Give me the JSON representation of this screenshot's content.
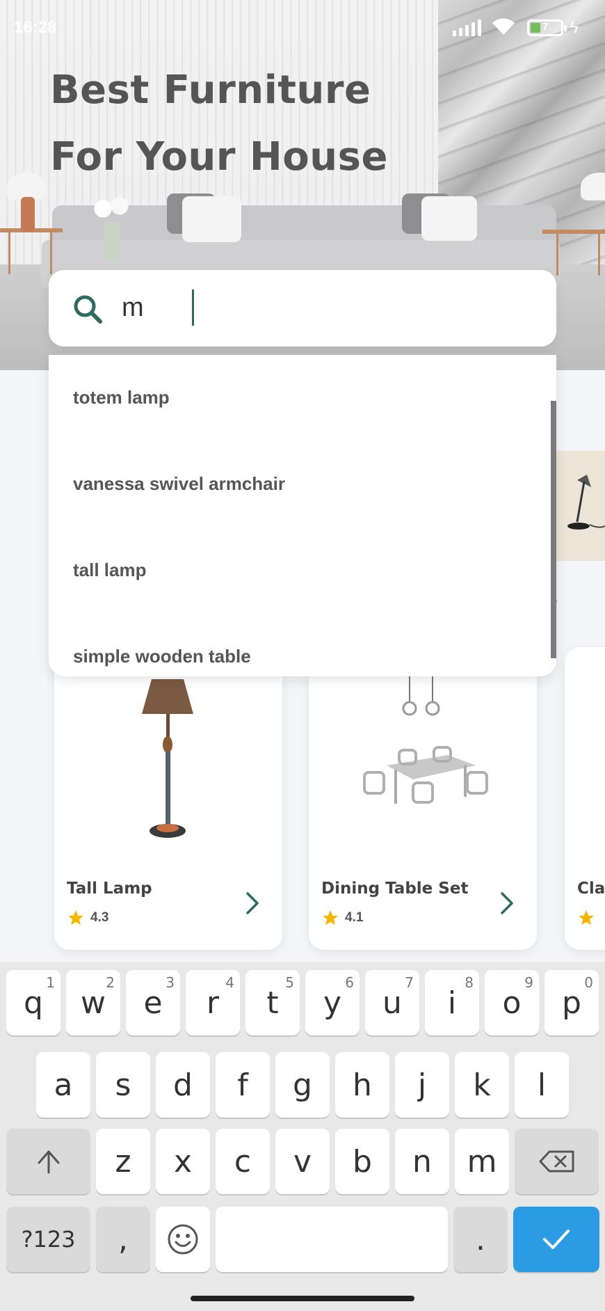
{
  "status_bar": {
    "time": "16:28",
    "battery": "7"
  },
  "hero": {
    "title_line1": "Best Furniture",
    "title_line2": "For Your House"
  },
  "search": {
    "value": "m",
    "placeholder": ""
  },
  "suggestions": [
    {
      "label": "totem lamp"
    },
    {
      "label": "vanessa swivel armchair"
    },
    {
      "label": "tall lamp"
    },
    {
      "label": "simple wooden table"
    }
  ],
  "products": [
    {
      "name": "Tall Lamp",
      "rating": "4.3"
    },
    {
      "name": "Dining Table Set",
      "rating": "4.1"
    },
    {
      "name": "Cla"
    }
  ],
  "keyboard": {
    "row1": [
      {
        "k": "q",
        "n": "1"
      },
      {
        "k": "w",
        "n": "2"
      },
      {
        "k": "e",
        "n": "3"
      },
      {
        "k": "r",
        "n": "4"
      },
      {
        "k": "t",
        "n": "5"
      },
      {
        "k": "y",
        "n": "6"
      },
      {
        "k": "u",
        "n": "7"
      },
      {
        "k": "i",
        "n": "8"
      },
      {
        "k": "o",
        "n": "9"
      },
      {
        "k": "p",
        "n": "0"
      }
    ],
    "row2": [
      "a",
      "s",
      "d",
      "f",
      "g",
      "h",
      "j",
      "k",
      "l"
    ],
    "row3": [
      "z",
      "x",
      "c",
      "v",
      "b",
      "n",
      "m"
    ],
    "symbols_label": "?123",
    "comma_label": ",",
    "period_label": "."
  },
  "colors": {
    "accent": "#2e6a60",
    "keyboard_enter": "#2b9be4",
    "star": "#f5b800"
  }
}
